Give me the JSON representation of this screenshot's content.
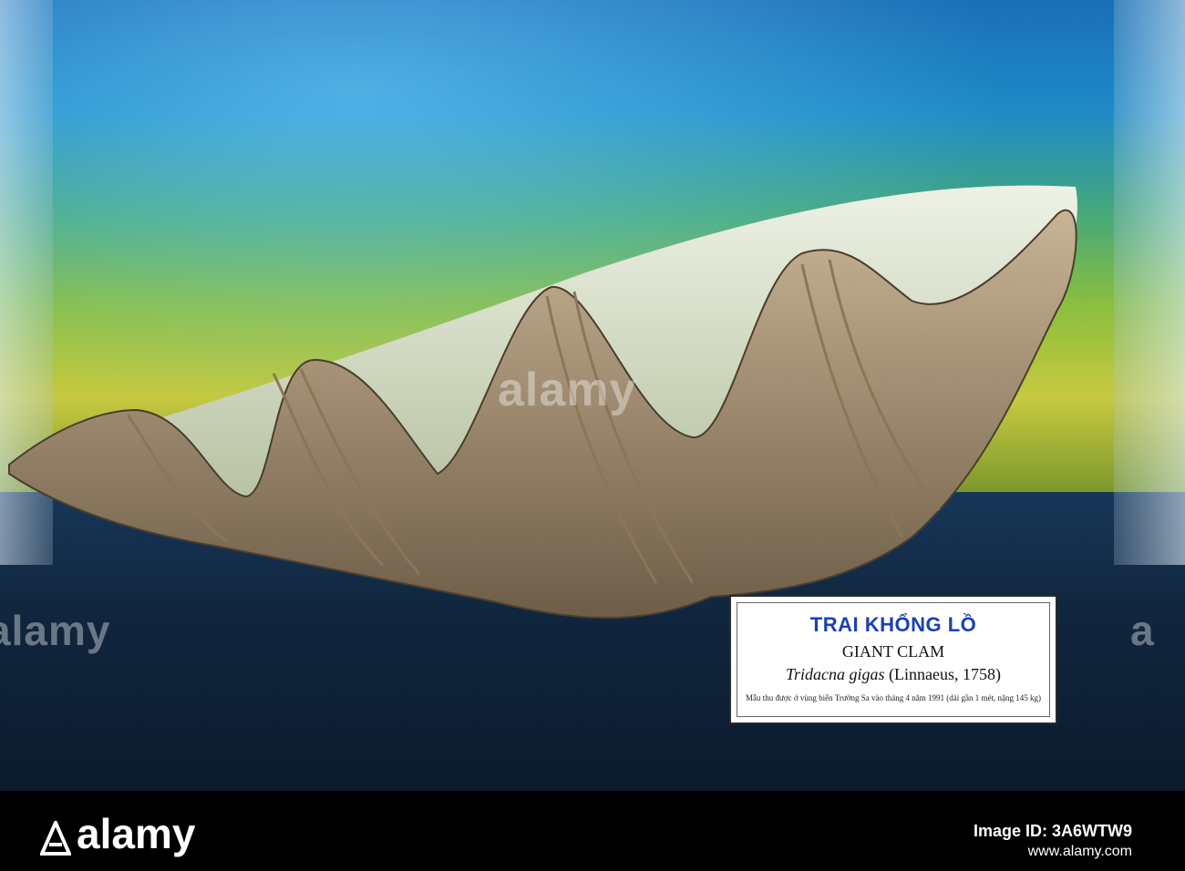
{
  "label": {
    "title_vi": "TRAI KHỔNG LỒ",
    "title_en": "GIANT CLAM",
    "scientific_name": "Tridacna gigas",
    "author_year": "(Linnaeus, 1758)",
    "note_vi": "Mẫu thu được ở vùng biển Trường Sa vào tháng 4 năm 1991 (dài gần 1 mét, nặng 145 kg)"
  },
  "watermarks": {
    "center": "alamy",
    "left": "alamy",
    "right": "a"
  },
  "stock_bar": {
    "brand": "alamy",
    "image_id": "Image ID: 3A6WTW9",
    "url": "www.alamy.com"
  },
  "colors": {
    "label_title": "#1a3fb8",
    "case_floor": "#10263e",
    "backdrop_top": "#1a6fb6",
    "backdrop_bottom": "#8bbf3e",
    "shell_outer": "#a38f6f",
    "shell_inner": "#dfe6d2"
  }
}
